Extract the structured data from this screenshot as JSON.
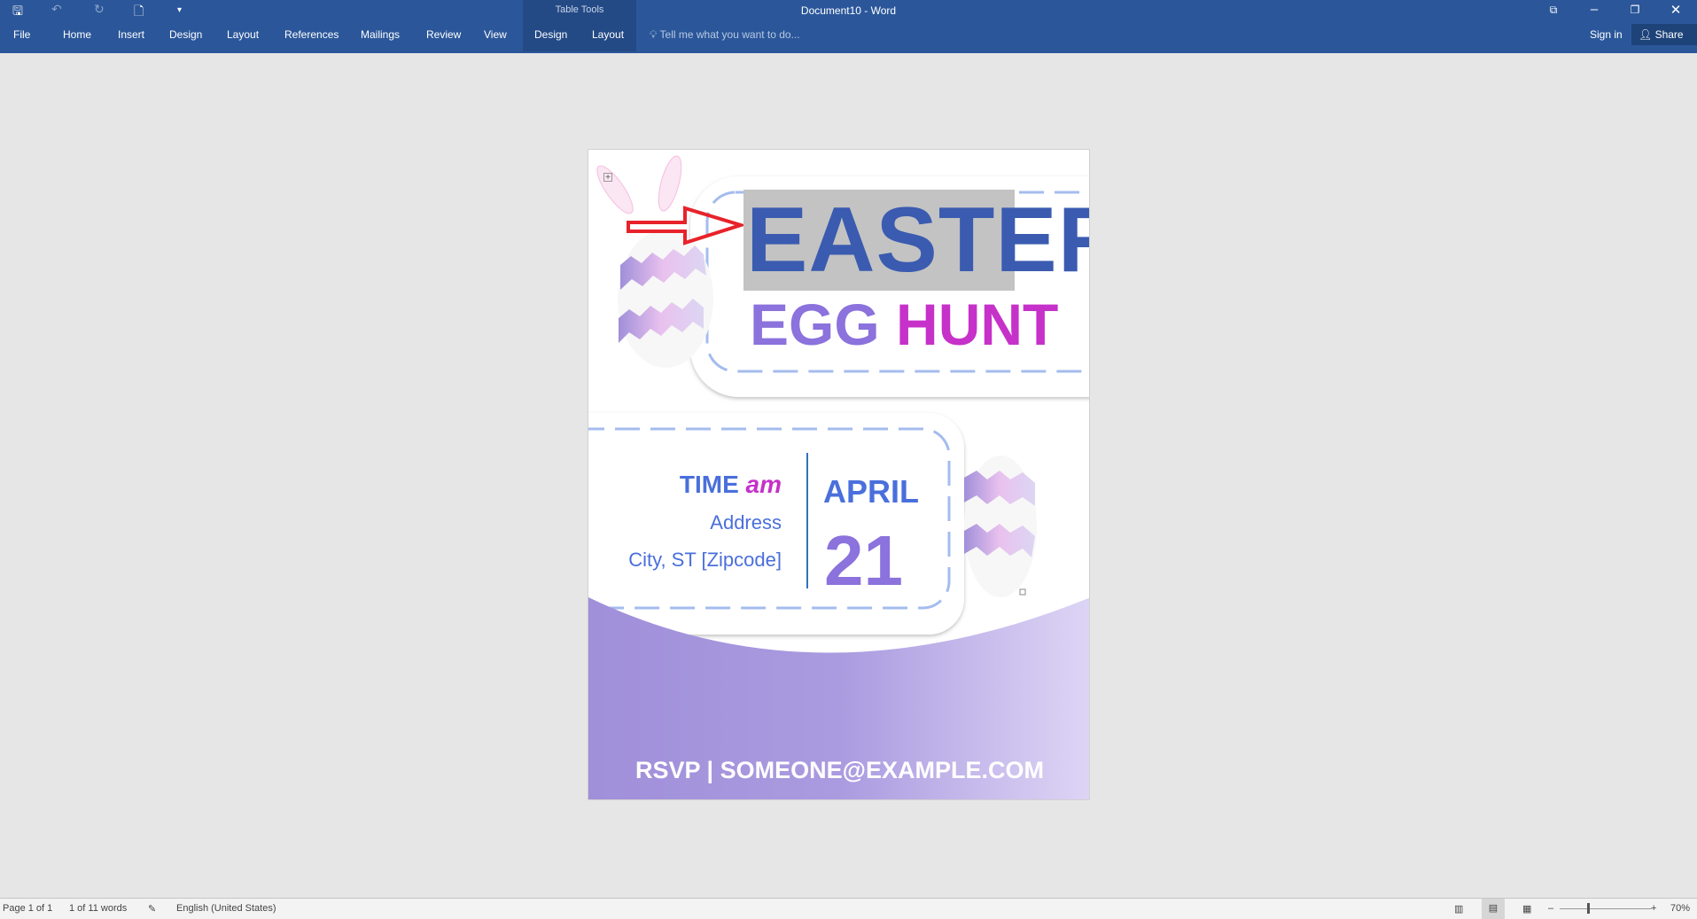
{
  "titlebar": {
    "doc_title": "Document10 - Word",
    "context_group": "Table Tools",
    "sign_in": "Sign in",
    "share": "Share",
    "tell_me": "Tell me what you want to do..."
  },
  "ribbon_tabs": [
    "File",
    "Home",
    "Insert",
    "Design",
    "Layout",
    "References",
    "Mailings",
    "Review",
    "View",
    "Design",
    "Layout"
  ],
  "flyer": {
    "title1": "EASTER",
    "title2a": "EGG",
    "title2b": "HUNT",
    "time_label": "TIME",
    "time_value": "am",
    "address": "Address",
    "city": "City, ST [Zipcode]",
    "month": "APRIL",
    "day": "21",
    "rsvp": "RSVP |  SOMEONE@EXAMPLE.COM"
  },
  "status": {
    "page": "Page 1 of 1",
    "words": "1 of 11 words",
    "language": "English (United States)",
    "zoom": "70%"
  },
  "colors": {
    "ribbon": "#2b579a",
    "title_blue": "#3a5bb0",
    "purple": "#8b72dc",
    "magenta": "#c631c9",
    "arrow": "#e8222a"
  }
}
